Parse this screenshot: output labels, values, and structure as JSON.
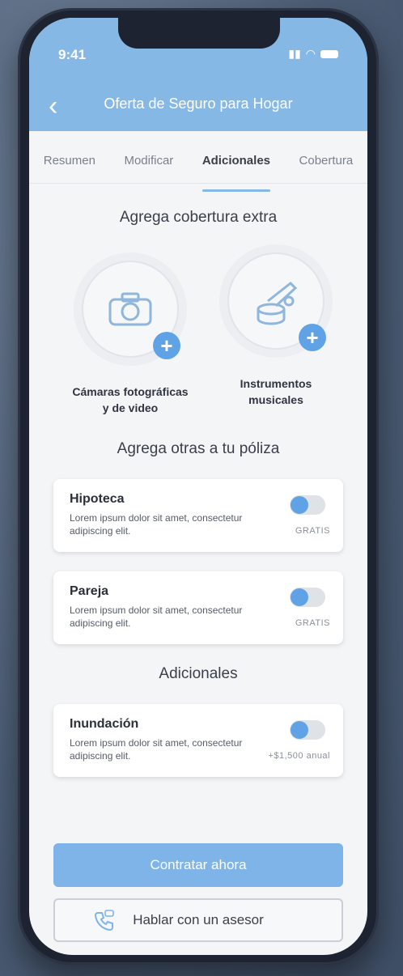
{
  "status_bar": {
    "time": "9:41"
  },
  "header": {
    "title": "Oferta de Seguro para Hogar"
  },
  "tabs": [
    {
      "label": "Resumen",
      "active": false
    },
    {
      "label": "Modificar",
      "active": false
    },
    {
      "label": "Adicionales",
      "active": true
    },
    {
      "label": "Cobertura",
      "active": false
    }
  ],
  "extra_coverage": {
    "title": "Agrega cobertura extra",
    "options": [
      {
        "label_line1": "Cámaras fotográficas",
        "label_line2": "y de video",
        "icon": "camera-icon"
      },
      {
        "label_line1": "Instrumentos",
        "label_line2": "musicales",
        "icon": "music-instruments-icon"
      }
    ]
  },
  "policy_addons": {
    "title": "Agrega otras a tu póliza",
    "items": [
      {
        "name": "Hipoteca",
        "description": "Lorem ipsum dolor sit amet, consectetur adipiscing elit.",
        "price": "GRATIS"
      },
      {
        "name": "Pareja",
        "description": "Lorem ipsum dolor sit amet, consectetur adipiscing elit.",
        "price": "GRATIS"
      }
    ]
  },
  "additionals": {
    "title": "Adicionales",
    "items": [
      {
        "name": "Inundación",
        "description": "Lorem ipsum dolor sit amet, consectetur adipiscing elit.",
        "price": "+$1,500 anual"
      }
    ]
  },
  "actions": {
    "primary": "Contratar ahora",
    "secondary": "Hablar con un asesor"
  },
  "colors": {
    "accent": "#86b8e6",
    "toggle_knob": "#5fa3e6"
  }
}
